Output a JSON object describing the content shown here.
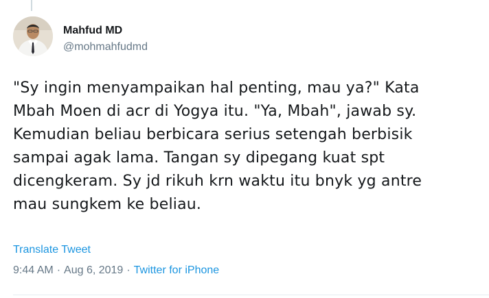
{
  "user": {
    "name": "Mahfud MD",
    "handle": "@mohmahfudmd"
  },
  "tweet": {
    "lines": [
      "\"Sy ingin menyampaikan hal penting, mau ya?\" Kata",
      "Mbah Moen di acr di Yogya itu. \"Ya, Mbah\", jawab sy.",
      "Kemudian beliau berbicara serius setengah berbisik",
      "sampai agak lama. Tangan sy dipegang kuat spt",
      "dicengkeram. Sy jd rikuh krn waktu itu bnyk yg antre",
      "mau sungkem ke beliau."
    ]
  },
  "translate_label": "Translate Tweet",
  "meta": {
    "time": "9:44 AM",
    "separator": "·",
    "date": "Aug 6, 2019",
    "source": "Twitter for iPhone"
  },
  "colors": {
    "link": "#1b95e0",
    "secondary_text": "#657786",
    "primary_text": "#14171a"
  }
}
